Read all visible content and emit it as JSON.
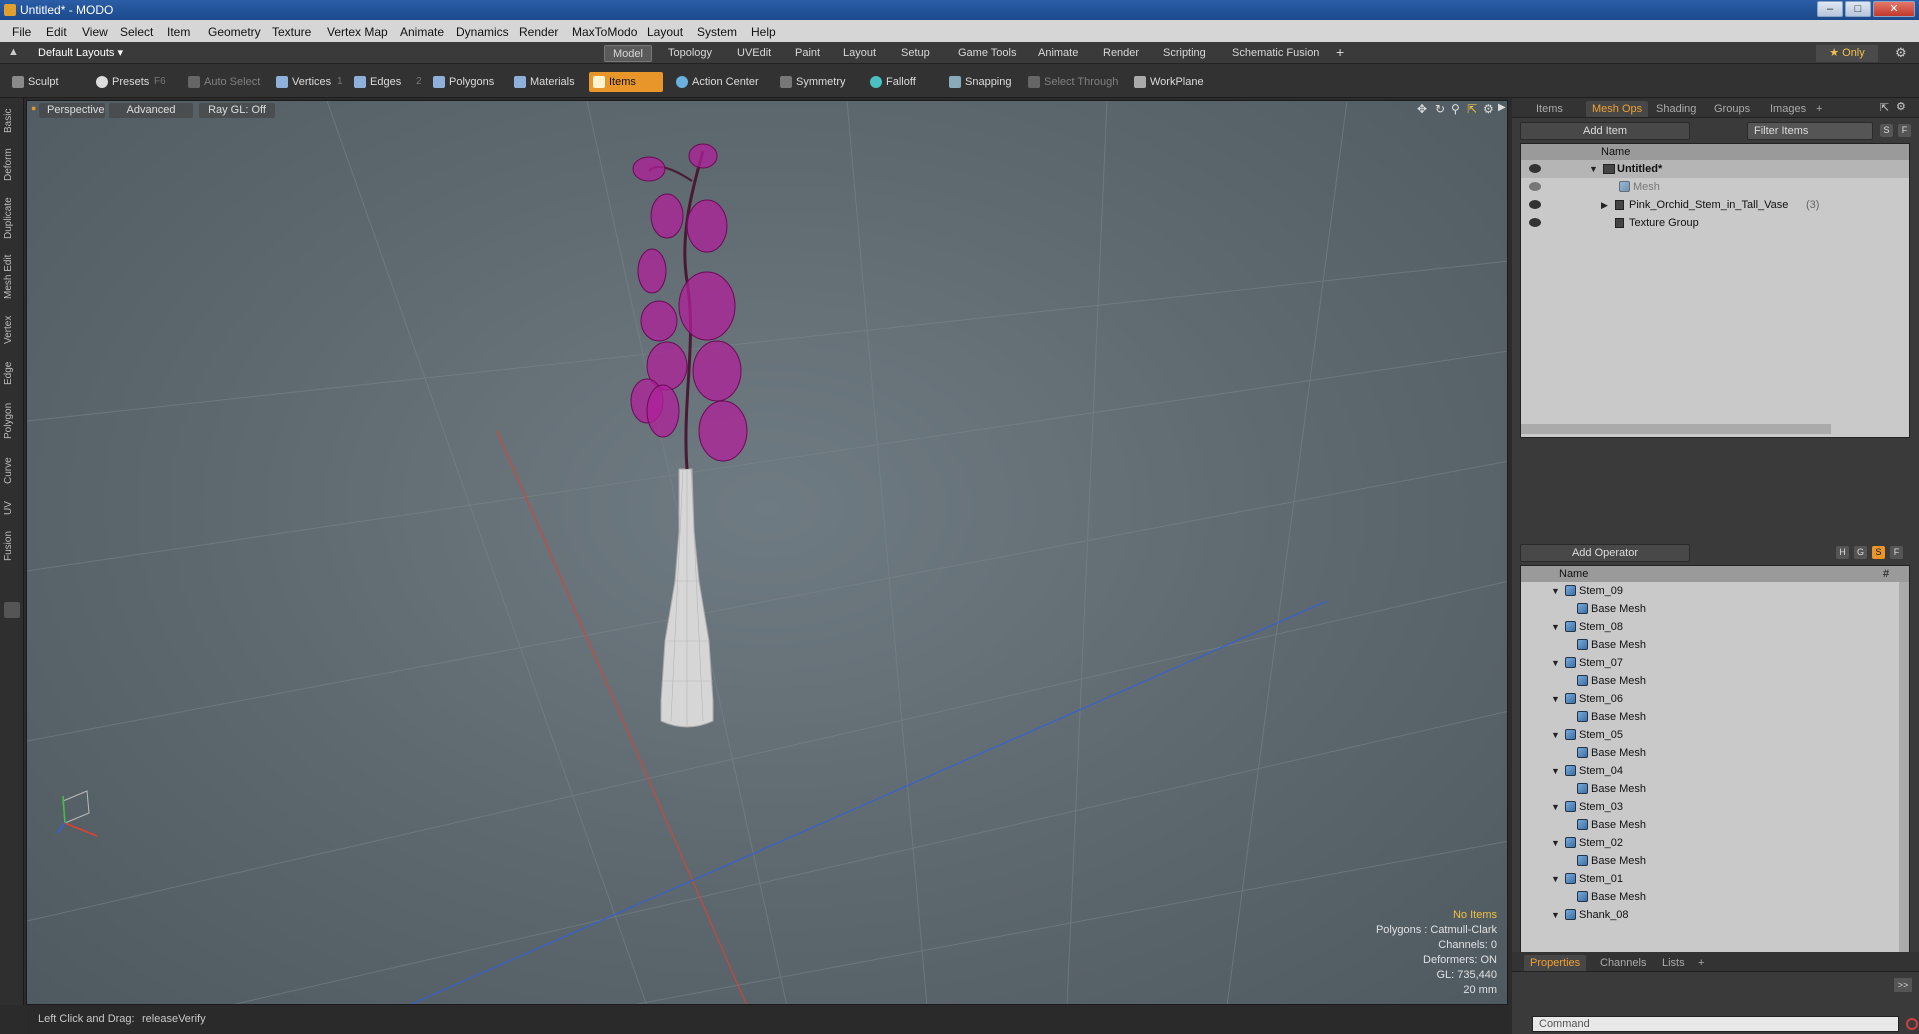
{
  "window": {
    "title": "Untitled* - MODO"
  },
  "menu": [
    "File",
    "Edit",
    "View",
    "Select",
    "Item",
    "Geometry",
    "Texture",
    "Vertex Map",
    "Animate",
    "Dynamics",
    "Render",
    "MaxToModo",
    "Layout",
    "System",
    "Help"
  ],
  "layouts": {
    "label": "Default Layouts ▾",
    "only": "★ Only"
  },
  "tabs": [
    "Model",
    "Topology",
    "UVEdit",
    "Paint",
    "Layout",
    "Setup",
    "Game Tools",
    "Animate",
    "Render",
    "Scripting",
    "Schematic Fusion",
    "+"
  ],
  "toolbar": {
    "sculpt": "Sculpt",
    "presets": "Presets",
    "presets_key": "F6",
    "auto_select": "Auto Select",
    "vertices": "Vertices",
    "vertices_key": "1",
    "edges": "Edges",
    "edges_key": "2",
    "polygons": "Polygons",
    "materials": "Materials",
    "items": "Items",
    "action_center": "Action Center",
    "symmetry": "Symmetry",
    "falloff": "Falloff",
    "snapping": "Snapping",
    "select_through": "Select Through",
    "workplane": "WorkPlane"
  },
  "left_tabs": [
    "Basic",
    "Deform",
    "Duplicate",
    "Mesh Edit",
    "Vertex",
    "Edge",
    "Polygon",
    "Curve",
    "UV",
    "Fusion"
  ],
  "viewport": {
    "perspective": "Perspective",
    "advanced": "Advanced",
    "raygl": "Ray GL: Off",
    "info": {
      "no_items": "No Items",
      "polygons": "Polygons : Catmull-Clark",
      "channels": "Channels: 0",
      "deformers": "Deformers: ON",
      "gl": "GL: 735,440",
      "scale": "20 mm"
    },
    "colors": {
      "petal": "#b0209a",
      "vase": "#d8d8d8",
      "axis_x": "#e04030",
      "axis_z": "#3060e0"
    }
  },
  "status": {
    "hint_label": "Left Click and Drag:",
    "hint_value": "releaseVerify"
  },
  "items_panel": {
    "tabs": [
      "Items",
      "Mesh Ops",
      "Shading",
      "Groups",
      "Images",
      "+"
    ],
    "add_item": "Add Item",
    "filter": "Filter Items",
    "sf": [
      "S",
      "F"
    ],
    "header": "Name",
    "rows": [
      {
        "label": "Untitled*"
      },
      {
        "label": "Mesh"
      },
      {
        "label": "Pink_Orchid_Stem_in_Tall_Vase",
        "count": "(3)"
      },
      {
        "label": "Texture Group"
      }
    ]
  },
  "meshops_panel": {
    "add_operator": "Add Operator",
    "badges": [
      "H",
      "G",
      "S",
      "F"
    ],
    "header": "Name",
    "hash": "#",
    "stems": [
      "Stem_09",
      "Stem_08",
      "Stem_07",
      "Stem_06",
      "Stem_05",
      "Stem_04",
      "Stem_03",
      "Stem_02",
      "Stem_01"
    ],
    "base_mesh": "Base Mesh",
    "last": "Shank_08"
  },
  "bottom_panel": {
    "tabs": [
      "Properties",
      "Channels",
      "Lists",
      "+"
    ],
    "expand": ">>",
    "command_placeholder": "Command"
  }
}
